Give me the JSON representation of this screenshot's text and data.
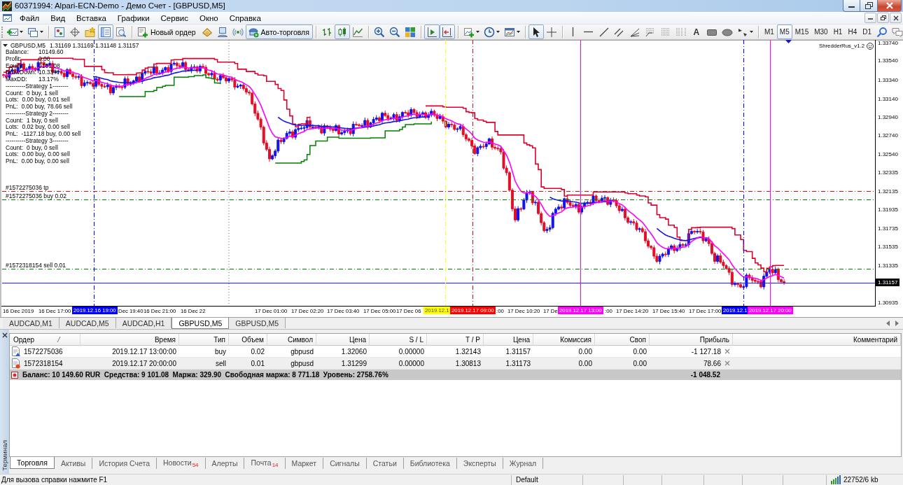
{
  "window": {
    "title": "60371994: Alpari-ECN-Demo - Демо Счет - [GBPUSD,M5]"
  },
  "menu": [
    {
      "label": "Файл"
    },
    {
      "label": "Вид"
    },
    {
      "label": "Вставка"
    },
    {
      "label": "Графики"
    },
    {
      "label": "Сервис"
    },
    {
      "label": "Окно"
    },
    {
      "label": "Справка"
    }
  ],
  "toolbar": [
    {
      "kind": "dropdown",
      "pressed": false
    },
    {
      "kind": "dropdown",
      "pressed": false
    },
    {
      "kind": "separator"
    },
    {
      "kind": "icon",
      "pressed": false
    },
    {
      "kind": "icon",
      "pressed": false
    },
    {
      "kind": "icon",
      "pressed": false
    },
    {
      "kind": "icon",
      "pressed": true
    },
    {
      "kind": "icon",
      "pressed": false
    },
    {
      "kind": "separator"
    },
    {
      "kind": "button",
      "label": "Новый ордер",
      "pressed": false
    },
    {
      "kind": "icon",
      "pressed": false
    },
    {
      "kind": "icon",
      "pressed": false
    },
    {
      "kind": "icon",
      "pressed": false
    },
    {
      "kind": "button",
      "label": "Авто-торговля",
      "pressed": true
    },
    {
      "kind": "separator"
    },
    {
      "kind": "icon",
      "pressed": false
    },
    {
      "kind": "icon",
      "pressed": true
    },
    {
      "kind": "icon",
      "pressed": false
    },
    {
      "kind": "separator"
    },
    {
      "kind": "icon",
      "pressed": false
    },
    {
      "kind": "icon",
      "pressed": false
    },
    {
      "kind": "icon",
      "pressed": false
    },
    {
      "kind": "separator"
    },
    {
      "kind": "icon",
      "pressed": true
    },
    {
      "kind": "icon",
      "pressed": true
    },
    {
      "kind": "separator"
    },
    {
      "kind": "dropdown",
      "pressed": false
    },
    {
      "kind": "dropdown",
      "pressed": false
    },
    {
      "kind": "dropdown",
      "pressed": false
    },
    {
      "kind": "separator"
    },
    {
      "kind": "icon",
      "pressed": true
    },
    {
      "kind": "icon",
      "pressed": false
    },
    {
      "kind": "separator"
    },
    {
      "kind": "icon",
      "pressed": false
    },
    {
      "kind": "icon",
      "pressed": false
    },
    {
      "kind": "icon",
      "pressed": false
    },
    {
      "kind": "icon",
      "pressed": false
    },
    {
      "kind": "icon",
      "pressed": false
    },
    {
      "kind": "icon",
      "pressed": false
    },
    {
      "kind": "icon",
      "pressed": false
    },
    {
      "kind": "icon",
      "pressed": false
    },
    {
      "kind": "glyph",
      "label": "A",
      "pressed": false
    },
    {
      "kind": "icon",
      "pressed": false
    },
    {
      "kind": "icon",
      "pressed": false
    },
    {
      "kind": "dropdown",
      "pressed": false
    },
    {
      "kind": "separator"
    },
    {
      "kind": "timeframe",
      "label": "M1",
      "selected": false
    },
    {
      "kind": "timeframe",
      "label": "M5",
      "selected": true
    },
    {
      "kind": "timeframe",
      "label": "M15",
      "selected": false
    },
    {
      "kind": "timeframe",
      "label": "M30",
      "selected": false
    },
    {
      "kind": "timeframe",
      "label": "H1",
      "selected": false
    },
    {
      "kind": "timeframe",
      "label": "H4",
      "selected": false
    },
    {
      "kind": "timeframe",
      "label": "D1",
      "selected": false
    },
    {
      "kind": "icon",
      "pressed": false
    },
    {
      "kind": "icon",
      "pressed": false
    }
  ],
  "chart": {
    "symbol": "GBPUSD,M5",
    "quote": "1.31169 1.31169 1.31148 1.31157",
    "expert": "ShredderRus_v1.2",
    "account": [
      {
        "label": "Balance:",
        "value": "10149.60"
      },
      {
        "label": "Profit:",
        "value": "0.00"
      },
      {
        "label": "Equity:",
        "value": "9101.08"
      },
      {
        "label": "DrawDown:",
        "value": "10.33%"
      },
      {
        "label": "MaxDD:",
        "value": "13.17%"
      }
    ],
    "strategies": [
      {
        "title": "----------Strategy 1--------",
        "rows": [
          {
            "label": "Count:",
            "value": "0 buy, 1 sell"
          },
          {
            "label": "Lots:",
            "value": "0.00 buy, 0.01 sell"
          },
          {
            "label": "PnL:",
            "value": "0.00 buy, 78.66 sell"
          }
        ]
      },
      {
        "title": "----------Strategy 2--------",
        "rows": [
          {
            "label": "Count:",
            "value": "1 buy, 0 sell"
          },
          {
            "label": "Lots:",
            "value": "0.02 buy, 0.00 sell"
          },
          {
            "label": "PnL:",
            "value": "-1127.18 buy, 0.00 sell"
          }
        ]
      },
      {
        "title": "----------Strategy 3--------",
        "rows": [
          {
            "label": "Count:",
            "value": "0 buy, 0 sell"
          },
          {
            "label": "Lots:",
            "value": "0.00 buy, 0.00 sell"
          },
          {
            "label": "PnL:",
            "value": "0.00 buy, 0.00 sell"
          }
        ]
      }
    ],
    "order_lines": [
      {
        "label": "#1572275036 tp",
        "color": "#ff0000",
        "dashed": true
      },
      {
        "label": "#1572275036 buy 0.02",
        "color": "#008000",
        "dashed": true
      },
      {
        "label": "#1572318154 sell 0.01",
        "color": "#008000",
        "dashed": true
      }
    ],
    "price_labels": [
      "1.33740",
      "1.33540",
      "1.33340",
      "1.33140",
      "1.32940",
      "1.32740",
      "1.32540",
      "1.32335",
      "1.32135",
      "1.31935",
      "1.31735",
      "1.31535",
      "1.31335",
      "1.30935"
    ],
    "bid": "1.31157",
    "time_labels": [
      "16 Dec 2019",
      "16 Dec 17:00",
      "Dec 19:40",
      "16 Dec 21:00",
      "16 Dec 22",
      "17 Dec 01:00",
      "17 Dec 02:20",
      "17 Dec 03:40",
      "17 Dec 05:00",
      "17 Dec 06",
      ":00",
      "17 Dec 10:20",
      "17 De",
      ":00",
      "17 Dec 14:20",
      "17 Dec 15:40",
      "17 Dec 17:00"
    ],
    "vertical_lines": [
      {
        "label": "2019.12.16 19:00",
        "color": "#0000ff",
        "dashed": true
      },
      {
        "label": "2019.12.1",
        "color": "#ffff00",
        "dashed": true
      },
      {
        "label": "2019.12.17 09:00",
        "color": "#ff0000",
        "dashed": true
      },
      {
        "label": "2019.12.17 13:00",
        "color": "#ff00ff",
        "dashed": false
      },
      {
        "label": "2019.12.1",
        "color": "#0000ff",
        "dashed": true
      },
      {
        "label": "2019.12.17 20:00",
        "color": "#ff00ff",
        "dashed": false
      }
    ]
  },
  "chart_tabs": [
    {
      "label": "AUDCAD,M1",
      "selected": false
    },
    {
      "label": "AUDCAD,M5",
      "selected": false
    },
    {
      "label": "AUDCAD,H1",
      "selected": false
    },
    {
      "label": "GBPUSD,M5",
      "selected": true
    },
    {
      "label": "GBPUSD,M5",
      "selected": false
    }
  ],
  "terminal": {
    "title": "Терминал",
    "columns": [
      {
        "label": "Ордер",
        "sorted": true
      },
      {
        "label": "Время",
        "sorted": false
      },
      {
        "label": "Тип",
        "sorted": false
      },
      {
        "label": "Объем",
        "sorted": false
      },
      {
        "label": "Символ",
        "sorted": false
      },
      {
        "label": "Цена",
        "sorted": false
      },
      {
        "label": "S / L",
        "sorted": false
      },
      {
        "label": "T / P",
        "sorted": false
      },
      {
        "label": "Цена",
        "sorted": false
      },
      {
        "label": "Комиссия",
        "sorted": false
      },
      {
        "label": "Своп",
        "sorted": false
      },
      {
        "label": "Прибыль",
        "sorted": false
      },
      {
        "label": "Комментарий",
        "sorted": false
      }
    ],
    "rows": [
      {
        "kind": "buy",
        "cells": [
          "1572275036",
          "2019.12.17 13:00:00",
          "buy",
          "0.02",
          "gbpusd",
          "1.32060",
          "0.00000",
          "1.32143",
          "1.31157",
          "0.00",
          "0.00",
          "-1 127.18"
        ]
      },
      {
        "kind": "sell",
        "cells": [
          "1572318154",
          "2019.12.17 20:00:00",
          "sell",
          "0.01",
          "gbpusd",
          "1.31299",
          "0.00000",
          "1.30813",
          "1.31173",
          "0.00",
          "0.00",
          "78.66"
        ]
      }
    ],
    "summary": {
      "text": "Баланс: 10 149.60 RUR  Средства: 9 101.08  Маржа: 329.90  Свободная маржа: 8 771.18  Уровень: 2758.76%",
      "profit": "-1 048.52"
    },
    "tabs": [
      {
        "label": "Торговля",
        "selected": true
      },
      {
        "label": "Активы",
        "selected": false
      },
      {
        "label": "История Счета",
        "selected": false
      },
      {
        "label": "Новости",
        "count": "54",
        "selected": false
      },
      {
        "label": "Алерты",
        "selected": false
      },
      {
        "label": "Почта",
        "count": "14",
        "selected": false
      },
      {
        "label": "Маркет",
        "selected": false
      },
      {
        "label": "Сигналы",
        "selected": false
      },
      {
        "label": "Статьи",
        "selected": false
      },
      {
        "label": "Библиотека",
        "selected": false
      },
      {
        "label": "Эксперты",
        "selected": false
      },
      {
        "label": "Журнал",
        "selected": false
      }
    ]
  },
  "status_bar": {
    "hint": "Для вызова справки нажмите F1",
    "profile": "Default",
    "traffic": "22752/6 kb"
  }
}
